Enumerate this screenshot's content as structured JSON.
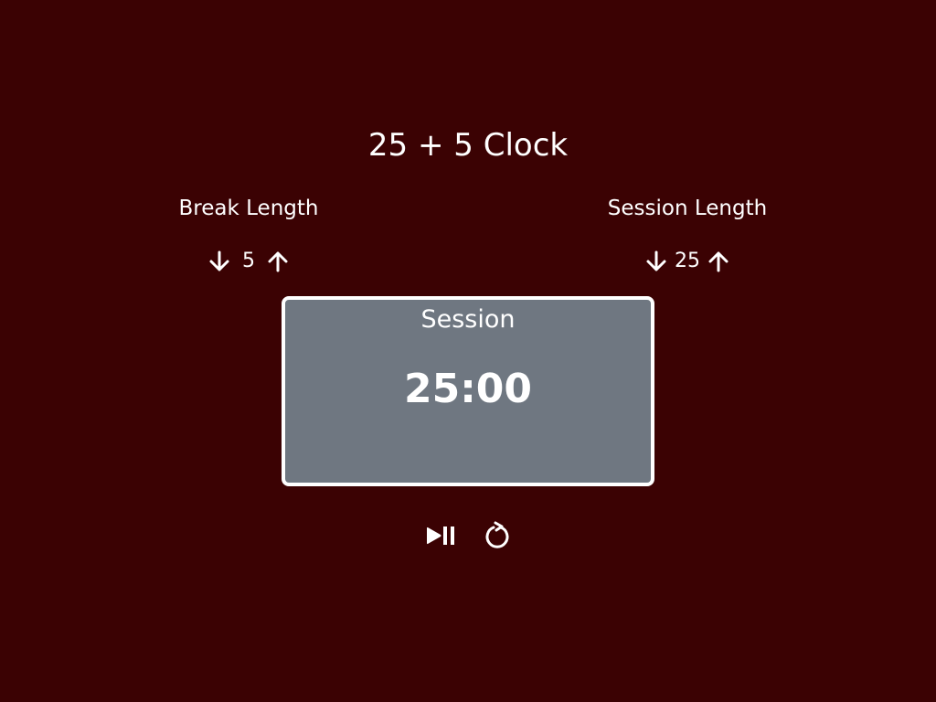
{
  "app": {
    "title": "25 + 5 Clock"
  },
  "break_length": {
    "label": "Break Length",
    "value": "5",
    "decrement_icon": "arrow-down-icon",
    "increment_icon": "arrow-up-icon"
  },
  "session_length": {
    "label": "Session Length",
    "value": "25",
    "decrement_icon": "arrow-down-icon",
    "increment_icon": "arrow-up-icon"
  },
  "timer": {
    "label": "Session",
    "time": "25:00"
  },
  "controls": {
    "start_stop_icon": "play-pause-icon",
    "reset_icon": "refresh-icon"
  },
  "colors": {
    "background": "#3b0203",
    "timer_background": "#6f7781",
    "text": "#ffffff"
  }
}
